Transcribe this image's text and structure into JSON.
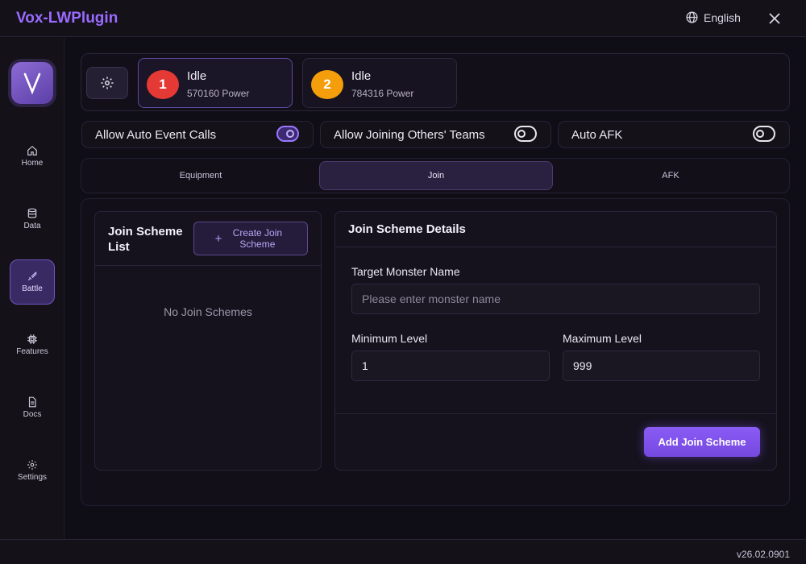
{
  "app": {
    "title": "Vox-LWPlugin",
    "language": "English"
  },
  "sidebar": {
    "items": [
      {
        "label": "Home",
        "icon": "home-icon"
      },
      {
        "label": "Data",
        "icon": "database-icon"
      },
      {
        "label": "Battle",
        "icon": "sword-icon",
        "active": true
      },
      {
        "label": "Features",
        "icon": "chip-icon"
      },
      {
        "label": "Docs",
        "icon": "document-icon"
      },
      {
        "label": "Settings",
        "icon": "gear-icon"
      }
    ]
  },
  "players": [
    {
      "number": "1",
      "status": "Idle",
      "power": "570160 Power",
      "color": "#e53935",
      "selected": true
    },
    {
      "number": "2",
      "status": "Idle",
      "power": "784316 Power",
      "color": "#f59e0b",
      "selected": false
    }
  ],
  "toggles": [
    {
      "label": "Allow Auto Event Calls",
      "on": true
    },
    {
      "label": "Allow Joining Others' Teams",
      "on": false
    },
    {
      "label": "Auto AFK",
      "on": false
    }
  ],
  "tabs": [
    {
      "label": "Equipment"
    },
    {
      "label": "Join",
      "active": true
    },
    {
      "label": "AFK"
    }
  ],
  "join_list": {
    "title": "Join Scheme List",
    "create_button": "Create Join Scheme",
    "empty_message": "No Join Schemes"
  },
  "details": {
    "title": "Join Scheme Details",
    "target_label": "Target Monster Name",
    "target_placeholder": "Please enter monster name",
    "target_value": "",
    "min_label": "Minimum Level",
    "min_value": "1",
    "max_label": "Maximum Level",
    "max_value": "999",
    "add_button": "Add Join Scheme"
  },
  "footer": {
    "version": "v26.02.0901"
  },
  "colors": {
    "accent": "#9b6bff",
    "button": "#8a5cf5"
  }
}
